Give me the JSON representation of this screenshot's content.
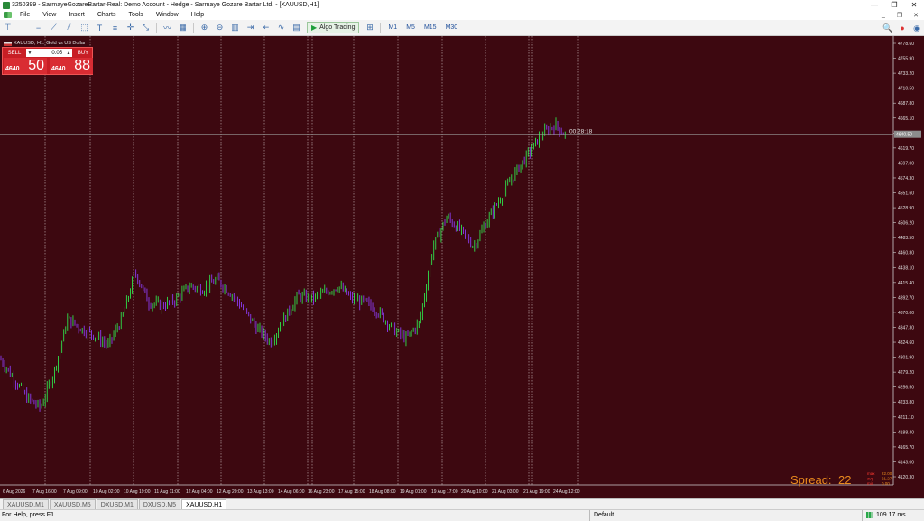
{
  "window": {
    "title": "3250399 - SarmayeGozareBartar-Real: Demo Account - Hedge - Sarmaye Gozare Bartar Ltd. - [XAUUSD,H1]"
  },
  "menu": [
    "File",
    "View",
    "Insert",
    "Charts",
    "Tools",
    "Window",
    "Help"
  ],
  "toolbar": {
    "algo_label": "Algo Trading",
    "timeframes": [
      "M1",
      "M5",
      "M15",
      "M30"
    ]
  },
  "trade_panel": {
    "symbol_label": "XAUUSD, H1:  Gold vs US Dollar",
    "sell_label": "SELL",
    "buy_label": "BUY",
    "lot": "0.05",
    "sell_price_small": "4640",
    "sell_price_big": "50",
    "buy_price_small": "4640",
    "buy_price_big": "88"
  },
  "chart": {
    "countdown": "00:28:18",
    "spread_label": "Spread:",
    "spread_value": "22",
    "stats": [
      {
        "k": "max",
        "v": "22.00"
      },
      {
        "k": "avg",
        "v": "21.27"
      },
      {
        "k": "min",
        "v": "0.00"
      }
    ],
    "current_price_tag": "4640.50",
    "colors": {
      "background": "#3d0810",
      "bull": "#2fe04a",
      "bear": "#8a3cf0",
      "text": "#e0e0e0",
      "spread": "#e98a1e"
    }
  },
  "chart_data": {
    "type": "candlestick",
    "price_ticks": [
      "4778.60",
      "4755.90",
      "4733.20",
      "4710.50",
      "4687.80",
      "4665.10",
      "4642.40",
      "4619.70",
      "4597.00",
      "4574.30",
      "4551.60",
      "4528.90",
      "4506.20",
      "4483.50",
      "4460.80",
      "4438.10",
      "4415.40",
      "4392.70",
      "4370.00",
      "4347.30",
      "4324.60",
      "4301.90",
      "4279.20",
      "4256.50",
      "4233.80",
      "4211.10",
      "4188.40",
      "4165.70",
      "4143.00",
      "4120.30"
    ],
    "time_ticks": [
      "6 Aug 2026",
      "7 Aug 16:00",
      "7 Aug 09:00",
      "10 Aug 02:00",
      "10 Aug 19:00",
      "11 Aug 11:00",
      "12 Aug 04:00",
      "12 Aug 20:00",
      "13 Aug 13:00",
      "14 Aug 06:00",
      "16 Aug 23:00",
      "17 Aug 15:00",
      "18 Aug 08:00",
      "19 Aug 01:00",
      "19 Aug 17:00",
      "20 Aug 10:00",
      "21 Aug 03:00",
      "21 Aug 19:00",
      "24 Aug 12:00"
    ],
    "close_path": [
      [
        0,
        4300
      ],
      [
        4,
        4270
      ],
      [
        8,
        4240
      ],
      [
        12,
        4225
      ],
      [
        16,
        4280
      ],
      [
        20,
        4360
      ],
      [
        24,
        4345
      ],
      [
        28,
        4335
      ],
      [
        32,
        4320
      ],
      [
        36,
        4360
      ],
      [
        40,
        4430
      ],
      [
        44,
        4385
      ],
      [
        48,
        4380
      ],
      [
        52,
        4390
      ],
      [
        56,
        4410
      ],
      [
        60,
        4405
      ],
      [
        64,
        4420
      ],
      [
        68,
        4400
      ],
      [
        72,
        4375
      ],
      [
        76,
        4345
      ],
      [
        80,
        4325
      ],
      [
        84,
        4360
      ],
      [
        88,
        4395
      ],
      [
        92,
        4390
      ],
      [
        96,
        4400
      ],
      [
        100,
        4410
      ],
      [
        104,
        4390
      ],
      [
        108,
        4385
      ],
      [
        112,
        4370
      ],
      [
        116,
        4345
      ],
      [
        120,
        4330
      ],
      [
        124,
        4355
      ],
      [
        128,
        4470
      ],
      [
        132,
        4515
      ],
      [
        136,
        4495
      ],
      [
        140,
        4470
      ],
      [
        144,
        4510
      ],
      [
        148,
        4545
      ],
      [
        152,
        4580
      ],
      [
        156,
        4610
      ],
      [
        160,
        4640
      ],
      [
        164,
        4655
      ],
      [
        168,
        4635
      ]
    ],
    "current_price": 4640.5
  }
}
